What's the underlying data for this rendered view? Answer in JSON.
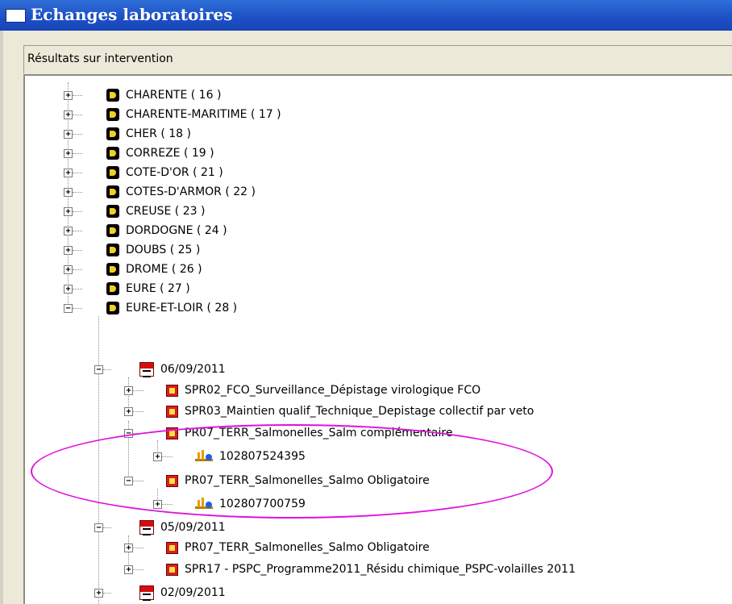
{
  "window": {
    "title": "Echanges laboratoires"
  },
  "section": {
    "label": "Résultats sur intervention"
  },
  "tree": {
    "departments": [
      {
        "label": "CHARENTE ( 16 )"
      },
      {
        "label": "CHARENTE-MARITIME ( 17 )"
      },
      {
        "label": "CHER ( 18 )"
      },
      {
        "label": "CORREZE ( 19 )"
      },
      {
        "label": "COTE-D'OR ( 21 )"
      },
      {
        "label": "COTES-D'ARMOR ( 22 )"
      },
      {
        "label": "CREUSE ( 23 )"
      },
      {
        "label": "DORDOGNE ( 24 )"
      },
      {
        "label": "DOUBS ( 25 )"
      },
      {
        "label": "DROME ( 26 )"
      },
      {
        "label": "EURE ( 27 )"
      },
      {
        "label": "EURE-ET-LOIR ( 28 )"
      }
    ],
    "dates": [
      {
        "label": "06/09/2011"
      },
      {
        "label": "05/09/2011"
      },
      {
        "label": "02/09/2011"
      }
    ],
    "analyses": [
      {
        "label": "SPR02_FCO_Surveillance_Dépistage virologique FCO"
      },
      {
        "label": "SPR03_Maintien qualif_Technique_Depistage collectif par veto"
      },
      {
        "label": "PR07_TERR_Salmonelles_Salm complémentaire"
      },
      {
        "label": "PR07_TERR_Salmonelles_Salmo Obligatoire"
      },
      {
        "label": "PR07_TERR_Salmonelles_Salmo Obligatoire"
      },
      {
        "label": "SPR17 - PSPC_Programme2011_Résidu chimique_PSPC-volailles 2011"
      }
    ],
    "results": [
      {
        "label": "102807524395"
      },
      {
        "label": "102807700759"
      }
    ],
    "plus": "+",
    "minus": "−"
  },
  "icons": {
    "department": "department-d-icon",
    "date": "calendar-icon",
    "analysis": "analysis-icon",
    "result": "lab-result-icon"
  },
  "colors": {
    "title_bar": "#1c4fc4",
    "highlight_oval": "#e010e0"
  }
}
